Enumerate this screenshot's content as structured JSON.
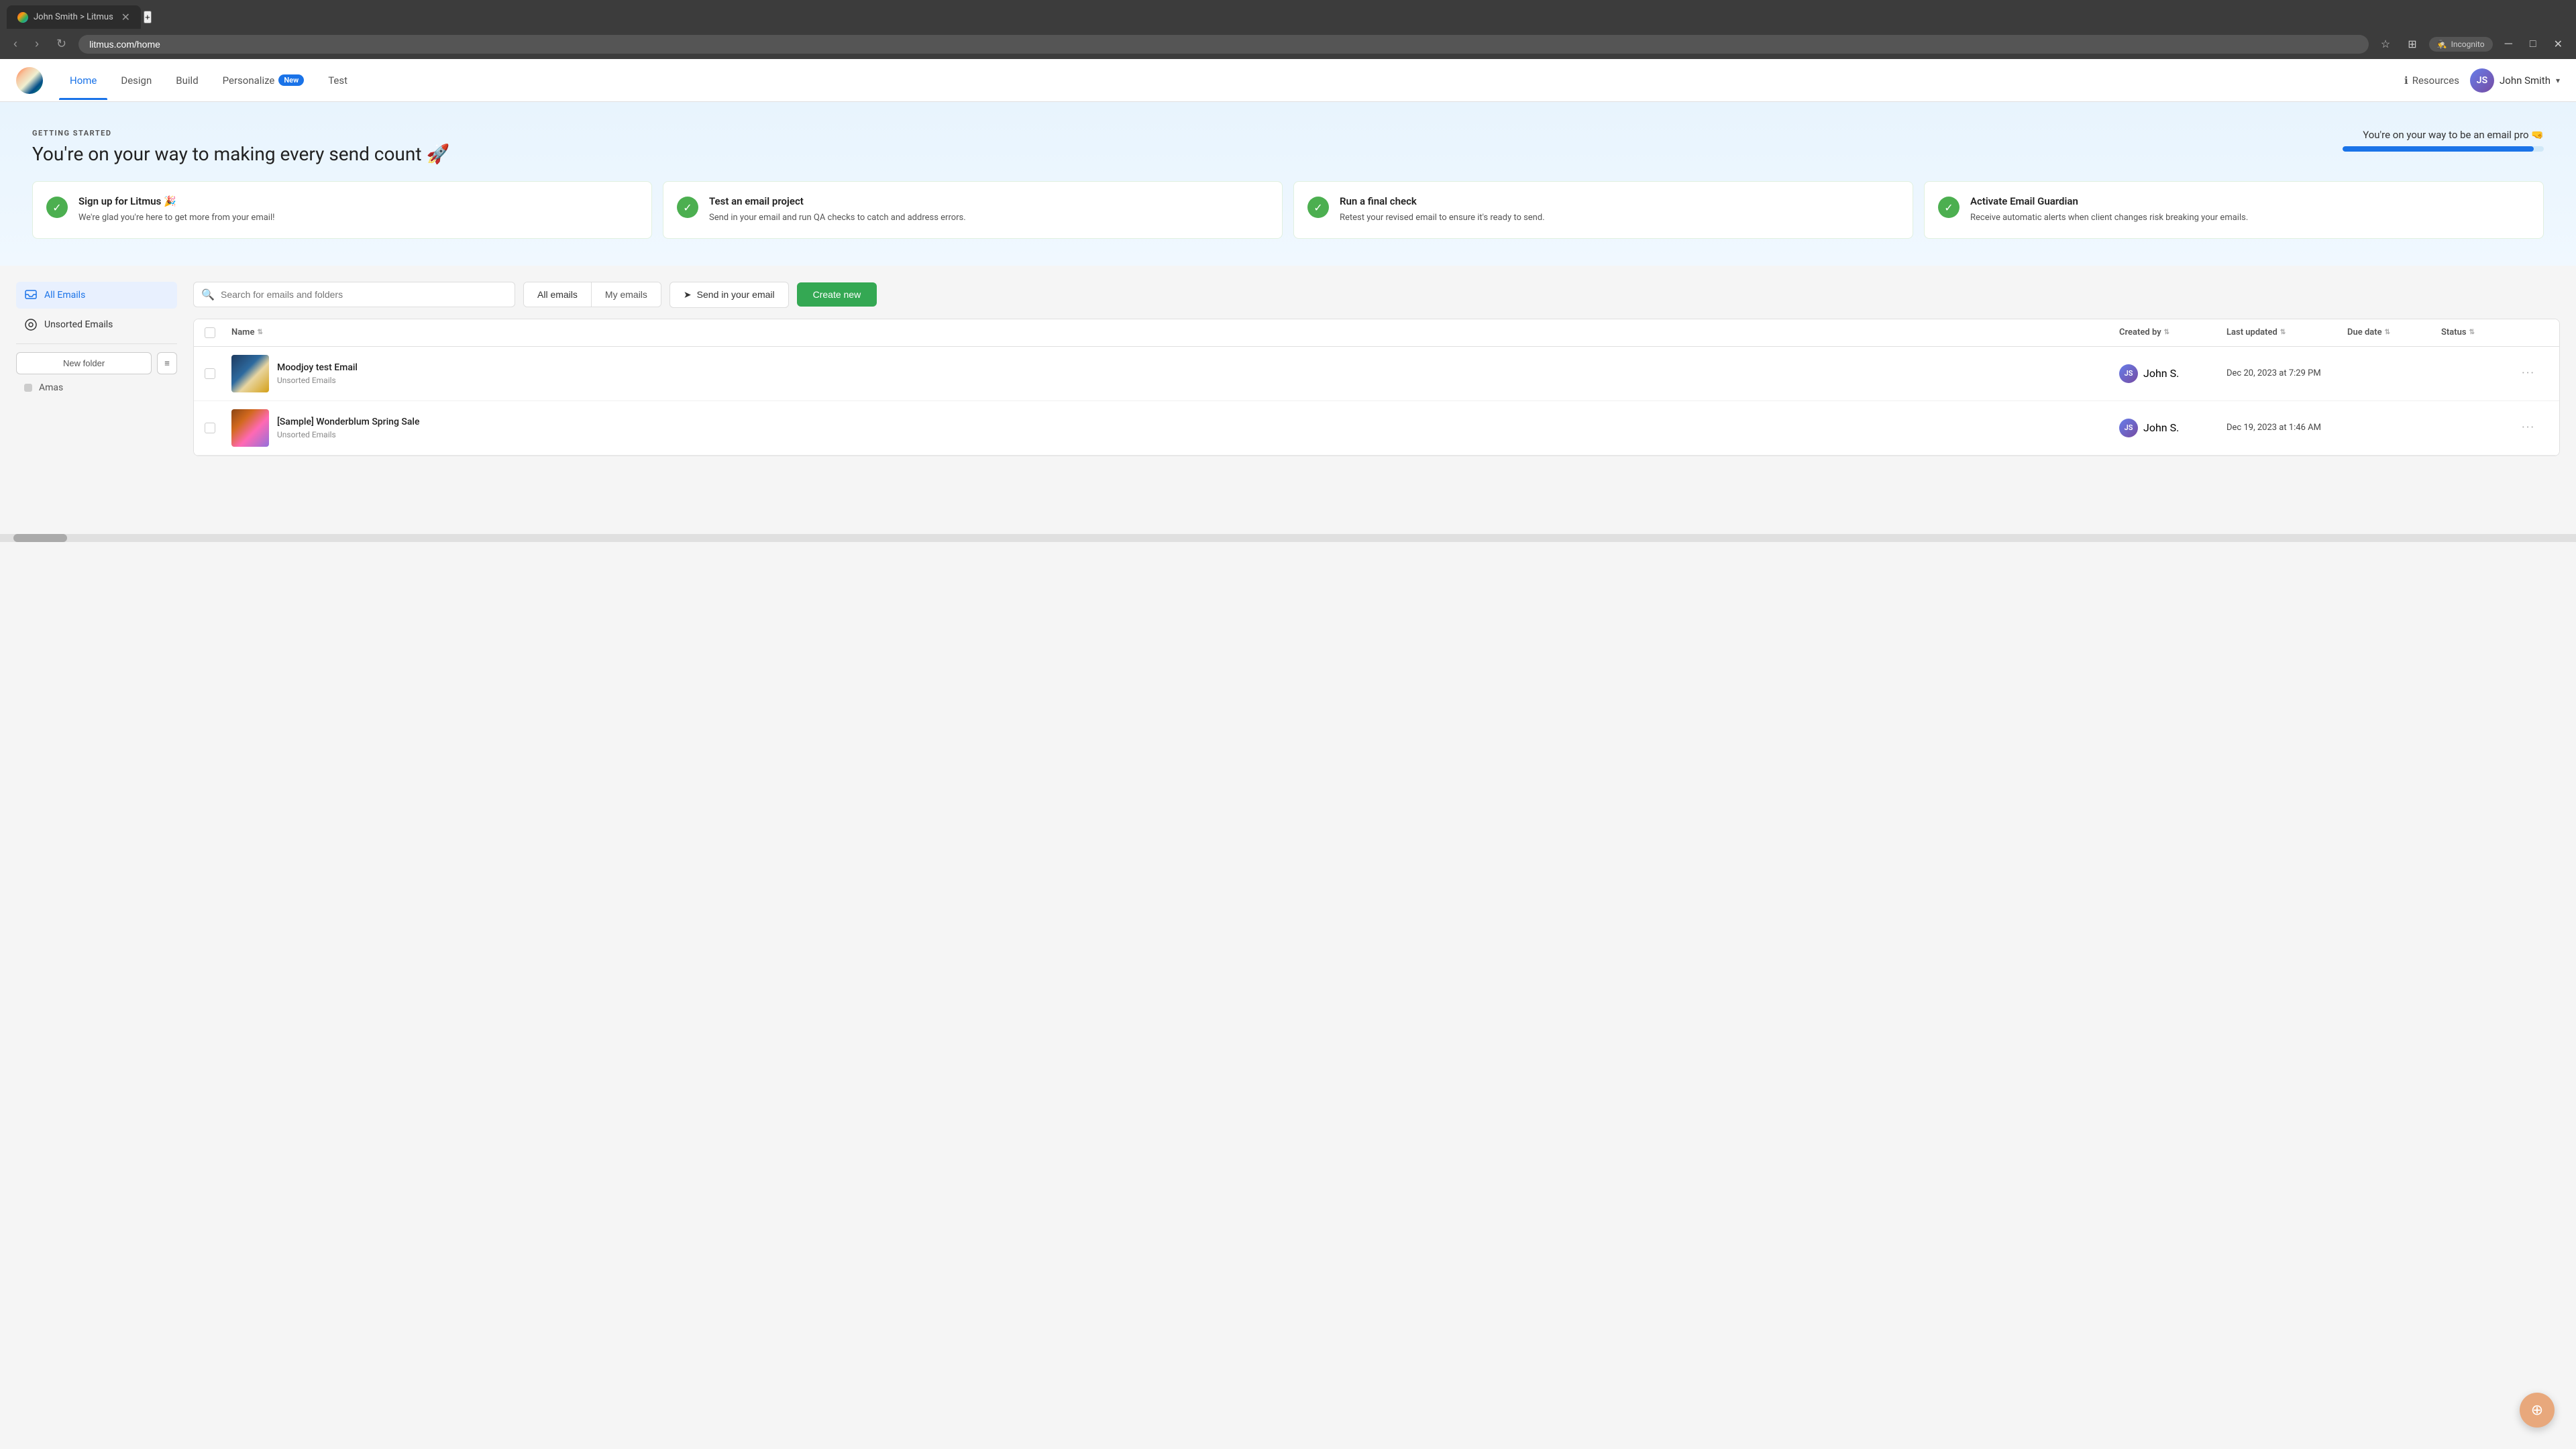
{
  "browser": {
    "tab_title": "John Smith > Litmus",
    "address": "litmus.com/home",
    "incognito_label": "Incognito"
  },
  "nav": {
    "home_label": "Home",
    "design_label": "Design",
    "build_label": "Build",
    "personalize_label": "Personalize",
    "personalize_badge": "New",
    "test_label": "Test",
    "resources_label": "Resources",
    "user_name": "John Smith",
    "user_initials": "JS"
  },
  "hero": {
    "getting_started": "GETTING STARTED",
    "title": "You're on your way to making every send count 🚀",
    "email_pro_text": "You're on your way to be an email pro 🤜",
    "progress_percent": 95,
    "cards": [
      {
        "title": "Sign up for Litmus 🎉",
        "desc": "We're glad you're here to get more from your email!"
      },
      {
        "title": "Test an email project",
        "desc": "Send in your email and run QA checks to catch and address errors."
      },
      {
        "title": "Run a final check",
        "desc": "Retest your revised email to ensure it's ready to send."
      },
      {
        "title": "Activate Email Guardian",
        "desc": "Receive automatic alerts when client changes risk breaking your emails."
      }
    ]
  },
  "sidebar": {
    "all_emails_label": "All Emails",
    "unsorted_label": "Unsorted Emails",
    "new_folder_label": "New folder",
    "folder_items": [
      {
        "label": "Amas"
      }
    ]
  },
  "toolbar": {
    "search_placeholder": "Search for emails and folders",
    "all_emails_filter": "All emails",
    "my_emails_filter": "My emails",
    "send_email_label": "Send in your email",
    "create_new_label": "Create new"
  },
  "table": {
    "col_name": "Name",
    "col_created_by": "Created by",
    "col_last_updated": "Last updated",
    "col_due_date": "Due date",
    "col_status": "Status",
    "rows": [
      {
        "name": "Moodjoy test Email",
        "folder": "Unsorted Emails",
        "created_by": "John S.",
        "last_updated": "Dec 20, 2023 at 7:29 PM",
        "due_date": "",
        "status": ""
      },
      {
        "name": "[Sample] Wonderblum Spring Sale",
        "folder": "Unsorted Emails",
        "created_by": "John S.",
        "last_updated": "Dec 19, 2023 at 1:46 AM",
        "due_date": "",
        "status": ""
      }
    ]
  }
}
